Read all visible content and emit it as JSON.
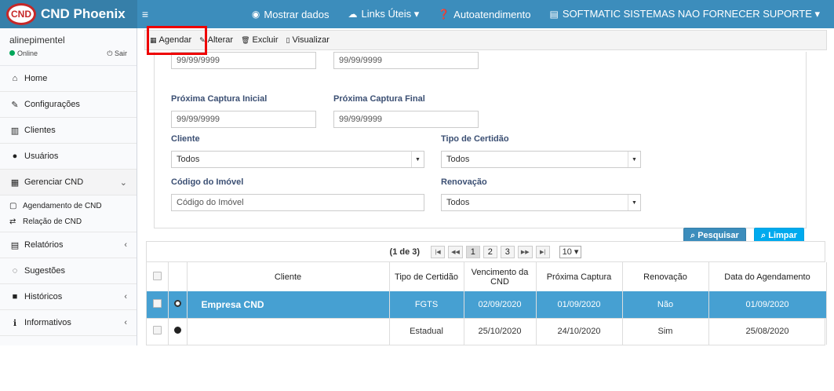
{
  "brand": {
    "logo": "CND",
    "title": "CND Phoenix",
    "menu_icon": "hamburger-icon"
  },
  "topnav": [
    {
      "label": "Mostrar dados",
      "icon": "eye-icon"
    },
    {
      "label": "Links Úteis ▾",
      "icon": "cloud-icon"
    },
    {
      "label": "Autoatendimento",
      "icon": "question-icon"
    },
    {
      "label": "SOFTMATIC SISTEMAS NAO FORNECER SUPORTE ▾",
      "icon": "building-icon"
    }
  ],
  "user": {
    "name": "alinepimentel",
    "status": "Online",
    "logout": "Sair"
  },
  "sidebar": {
    "home": "Home",
    "config": "Configurações",
    "clientes": "Clientes",
    "usuarios": "Usuários",
    "gerenciar": "Gerenciar CND",
    "agendamento": "Agendamento de CND",
    "relacao": "Relação de CND",
    "relatorios": "Relatórios",
    "sugestoes": "Sugestões",
    "historicos": "Históricos",
    "informativos": "Informativos"
  },
  "toolbar": {
    "agendar": "Agendar",
    "alterar": "Alterar",
    "excluir": "Excluir",
    "visualizar": "Visualizar"
  },
  "filters": {
    "top_left_value": "99/99/9999",
    "top_right_value": "99/99/9999",
    "proxima_inicial_label": "Próxima Captura Inicial",
    "proxima_inicial_value": "99/99/9999",
    "proxima_final_label": "Próxima Captura Final",
    "proxima_final_value": "99/99/9999",
    "cliente_label": "Cliente",
    "cliente_value": "Todos",
    "tipo_label": "Tipo de Certidão",
    "tipo_value": "Todos",
    "imovel_label": "Código do Imóvel",
    "imovel_placeholder": "Código do Imóvel",
    "renovacao_label": "Renovação",
    "renovacao_value": "Todos",
    "pesquisar": "Pesquisar",
    "limpar": "Limpar"
  },
  "pager": {
    "info": "(1 de 3)",
    "pages": [
      "1",
      "2",
      "3"
    ],
    "per_page": "10 ▾"
  },
  "table": {
    "headers": [
      "Cliente",
      "Tipo de Certidão",
      "Vencimento da CND",
      "Próxima Captura",
      "Renovação",
      "Data do Agendamento"
    ],
    "rows": [
      {
        "cliente": "Empresa CND",
        "tipo": "FGTS",
        "vencimento": "02/09/2020",
        "proxima": "01/09/2020",
        "renovacao": "Não",
        "agendamento": "01/09/2020"
      },
      {
        "cliente": "",
        "tipo": "Estadual",
        "vencimento": "25/10/2020",
        "proxima": "24/10/2020",
        "renovacao": "Sim",
        "agendamento": "25/08/2020"
      }
    ]
  }
}
